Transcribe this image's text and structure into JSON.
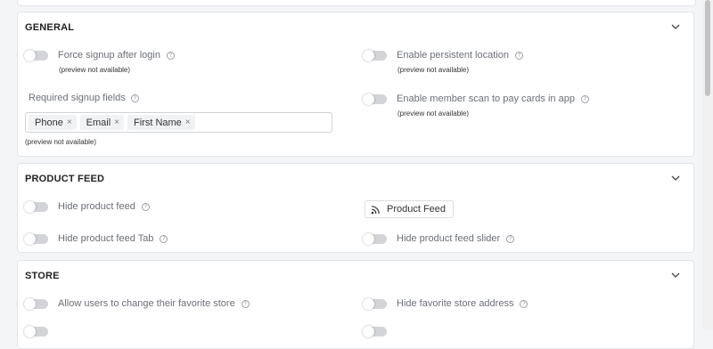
{
  "general": {
    "title": "GENERAL",
    "force_signup": "Force signup after login",
    "force_signup_note": "(preview not available)",
    "persistent_location": "Enable persistent location",
    "persistent_location_note": "(preview not available)",
    "required_fields_label": "Required signup fields",
    "tags": [
      "Phone",
      "Email",
      "First Name"
    ],
    "tag_remove": "×",
    "required_fields_note": "(preview not available)",
    "member_scan": "Enable member scan to pay cards in app",
    "member_scan_note": "(preview not available)"
  },
  "product_feed": {
    "title": "PRODUCT FEED",
    "hide_feed": "Hide product feed",
    "feed_button": "Product Feed",
    "hide_feed_tab": "Hide product feed Tab",
    "hide_feed_slider": "Hide product feed slider"
  },
  "store": {
    "title": "STORE",
    "allow_change_store": "Allow users to change their favorite store",
    "hide_store_address": "Hide favorite store address"
  },
  "help_glyph": "?",
  "colors": {
    "toggle_off": "#d3d4d7",
    "card_border": "#e3e4e8",
    "background": "#f4f5f7"
  }
}
